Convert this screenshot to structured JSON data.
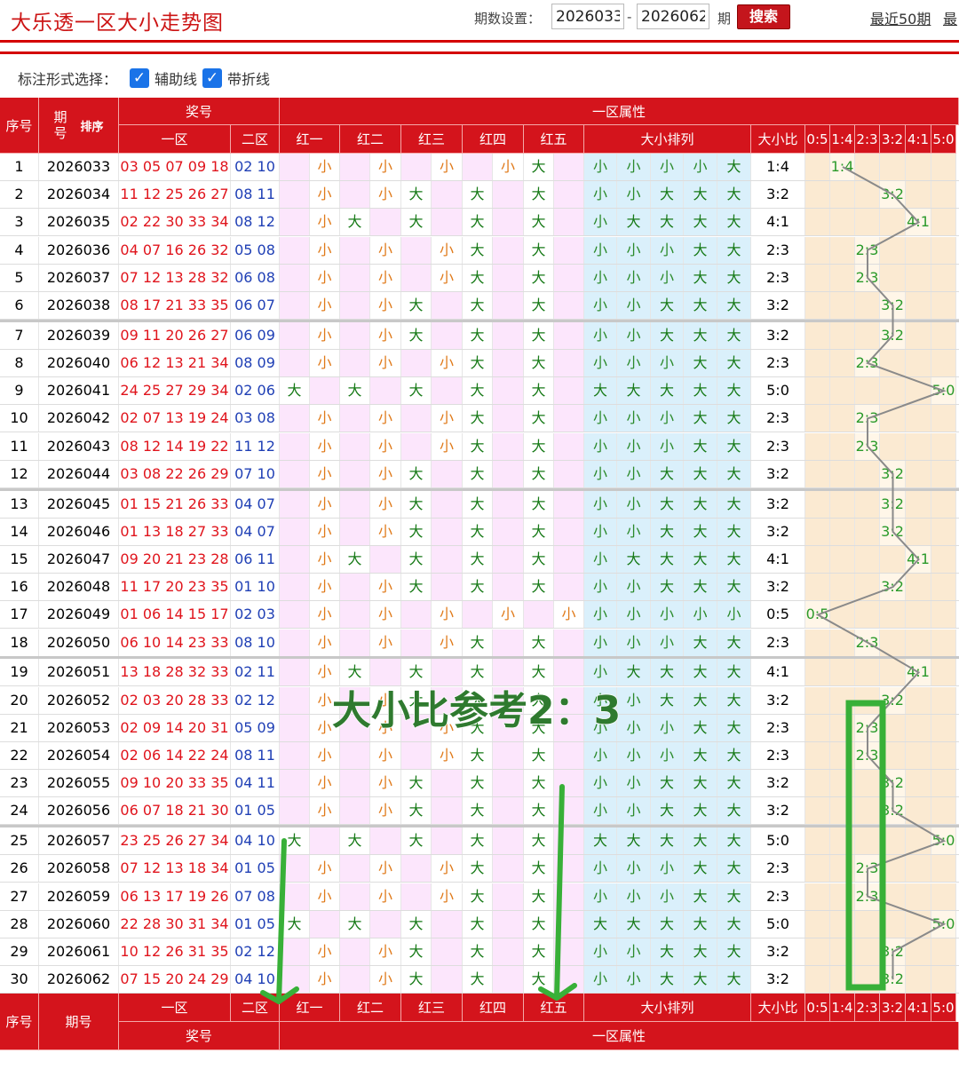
{
  "header": {
    "title": "大乐透一区大小走势图",
    "period_label": "期数设置：",
    "start": "2026033",
    "dash": "-",
    "end": "2026062",
    "qi": "期",
    "search": "搜索",
    "recent": "最近50期",
    "recent_cut": "最"
  },
  "options": {
    "label": "标注形式选择：",
    "aux": "辅助线",
    "fold": "带折线",
    "check": "✓"
  },
  "head_top": {
    "seq": "序号",
    "period": "期号",
    "sort": "排序",
    "prize": "奖号",
    "attr": "一区属性",
    "zone1": "一区",
    "zone2": "二区",
    "h": [
      "红一",
      "红二",
      "红三",
      "红四",
      "红五"
    ],
    "arr": "大小排列",
    "ratio": "大小比",
    "ratios": [
      "0:5",
      "1:4",
      "2:3",
      "3:2",
      "4:1",
      "5:0"
    ]
  },
  "head_bot": {
    "seq": "序号",
    "period": "期号",
    "zone1": "一区",
    "zone2": "二区",
    "h": [
      "红一",
      "红二",
      "红三",
      "红四",
      "红五"
    ],
    "arr": "大小排列",
    "ratio": "大小比",
    "ratios": [
      "0:5",
      "1:4",
      "2:3",
      "3:2",
      "4:1",
      "5:0"
    ],
    "prize": "奖号",
    "attr": "一区属性"
  },
  "annotation": "大小比参考2：3",
  "rows": [
    {
      "n": "1",
      "p": "2026033",
      "r": "03 05 07 09 18",
      "b": "02 10",
      "h": [
        0,
        0,
        0,
        0,
        1
      ],
      "ratio": "1:4"
    },
    {
      "n": "2",
      "p": "2026034",
      "r": "11 12 25 26 27",
      "b": "08 11",
      "h": [
        0,
        0,
        1,
        1,
        1
      ],
      "ratio": "3:2"
    },
    {
      "n": "3",
      "p": "2026035",
      "r": "02 22 30 33 34",
      "b": "08 12",
      "h": [
        0,
        1,
        1,
        1,
        1
      ],
      "ratio": "4:1"
    },
    {
      "n": "4",
      "p": "2026036",
      "r": "04 07 16 26 32",
      "b": "05 08",
      "h": [
        0,
        0,
        0,
        1,
        1
      ],
      "ratio": "2:3"
    },
    {
      "n": "5",
      "p": "2026037",
      "r": "07 12 13 28 32",
      "b": "06 08",
      "h": [
        0,
        0,
        0,
        1,
        1
      ],
      "ratio": "2:3"
    },
    {
      "n": "6",
      "p": "2026038",
      "r": "08 17 21 33 35",
      "b": "06 07",
      "h": [
        0,
        0,
        1,
        1,
        1
      ],
      "ratio": "3:2"
    },
    {
      "n": "7",
      "p": "2026039",
      "r": "09 11 20 26 27",
      "b": "06 09",
      "h": [
        0,
        0,
        1,
        1,
        1
      ],
      "ratio": "3:2"
    },
    {
      "n": "8",
      "p": "2026040",
      "r": "06 12 13 21 34",
      "b": "08 09",
      "h": [
        0,
        0,
        0,
        1,
        1
      ],
      "ratio": "2:3"
    },
    {
      "n": "9",
      "p": "2026041",
      "r": "24 25 27 29 34",
      "b": "02 06",
      "h": [
        1,
        1,
        1,
        1,
        1
      ],
      "ratio": "5:0"
    },
    {
      "n": "10",
      "p": "2026042",
      "r": "02 07 13 19 24",
      "b": "03 08",
      "h": [
        0,
        0,
        0,
        1,
        1
      ],
      "ratio": "2:3"
    },
    {
      "n": "11",
      "p": "2026043",
      "r": "08 12 14 19 22",
      "b": "11 12",
      "h": [
        0,
        0,
        0,
        1,
        1
      ],
      "ratio": "2:3"
    },
    {
      "n": "12",
      "p": "2026044",
      "r": "03 08 22 26 29",
      "b": "07 10",
      "h": [
        0,
        0,
        1,
        1,
        1
      ],
      "ratio": "3:2"
    },
    {
      "n": "13",
      "p": "2026045",
      "r": "01 15 21 26 33",
      "b": "04 07",
      "h": [
        0,
        0,
        1,
        1,
        1
      ],
      "ratio": "3:2"
    },
    {
      "n": "14",
      "p": "2026046",
      "r": "01 13 18 27 33",
      "b": "04 07",
      "h": [
        0,
        0,
        1,
        1,
        1
      ],
      "ratio": "3:2"
    },
    {
      "n": "15",
      "p": "2026047",
      "r": "09 20 21 23 28",
      "b": "06 11",
      "h": [
        0,
        1,
        1,
        1,
        1
      ],
      "ratio": "4:1"
    },
    {
      "n": "16",
      "p": "2026048",
      "r": "11 17 20 23 35",
      "b": "01 10",
      "h": [
        0,
        0,
        1,
        1,
        1
      ],
      "ratio": "3:2"
    },
    {
      "n": "17",
      "p": "2026049",
      "r": "01 06 14 15 17",
      "b": "02 03",
      "h": [
        0,
        0,
        0,
        0,
        0
      ],
      "ratio": "0:5"
    },
    {
      "n": "18",
      "p": "2026050",
      "r": "06 10 14 23 33",
      "b": "08 10",
      "h": [
        0,
        0,
        0,
        1,
        1
      ],
      "ratio": "2:3"
    },
    {
      "n": "19",
      "p": "2026051",
      "r": "13 18 28 32 33",
      "b": "02 11",
      "h": [
        0,
        1,
        1,
        1,
        1
      ],
      "ratio": "4:1"
    },
    {
      "n": "20",
      "p": "2026052",
      "r": "02 03 20 28 33",
      "b": "02 12",
      "h": [
        0,
        0,
        1,
        1,
        1
      ],
      "ratio": "3:2"
    },
    {
      "n": "21",
      "p": "2026053",
      "r": "02 09 14 20 31",
      "b": "05 09",
      "h": [
        0,
        0,
        0,
        1,
        1
      ],
      "ratio": "2:3"
    },
    {
      "n": "22",
      "p": "2026054",
      "r": "02 06 14 22 24",
      "b": "08 11",
      "h": [
        0,
        0,
        0,
        1,
        1
      ],
      "ratio": "2:3"
    },
    {
      "n": "23",
      "p": "2026055",
      "r": "09 10 20 33 35",
      "b": "04 11",
      "h": [
        0,
        0,
        1,
        1,
        1
      ],
      "ratio": "3:2"
    },
    {
      "n": "24",
      "p": "2026056",
      "r": "06 07 18 21 30",
      "b": "01 05",
      "h": [
        0,
        0,
        1,
        1,
        1
      ],
      "ratio": "3:2"
    },
    {
      "n": "25",
      "p": "2026057",
      "r": "23 25 26 27 34",
      "b": "04 10",
      "h": [
        1,
        1,
        1,
        1,
        1
      ],
      "ratio": "5:0"
    },
    {
      "n": "26",
      "p": "2026058",
      "r": "07 12 13 18 34",
      "b": "01 05",
      "h": [
        0,
        0,
        0,
        1,
        1
      ],
      "ratio": "2:3"
    },
    {
      "n": "27",
      "p": "2026059",
      "r": "06 13 17 19 26",
      "b": "07 08",
      "h": [
        0,
        0,
        0,
        1,
        1
      ],
      "ratio": "2:3"
    },
    {
      "n": "28",
      "p": "2026060",
      "r": "22 28 30 31 34",
      "b": "01 05",
      "h": [
        1,
        1,
        1,
        1,
        1
      ],
      "ratio": "5:0"
    },
    {
      "n": "29",
      "p": "2026061",
      "r": "10 12 26 31 35",
      "b": "02 12",
      "h": [
        0,
        0,
        1,
        1,
        1
      ],
      "ratio": "3:2"
    },
    {
      "n": "30",
      "p": "2026062",
      "r": "07 15 20 24 29",
      "b": "04 10",
      "h": [
        0,
        0,
        1,
        1,
        1
      ],
      "ratio": "3:2"
    }
  ],
  "labels": {
    "big": "大",
    "small": "小"
  },
  "colors": {
    "brand_red": "#d4141c",
    "pink": "#fce6fc",
    "blue": "#daf0fb",
    "tan": "#fbead2",
    "green_annot": "#3cad3c"
  }
}
